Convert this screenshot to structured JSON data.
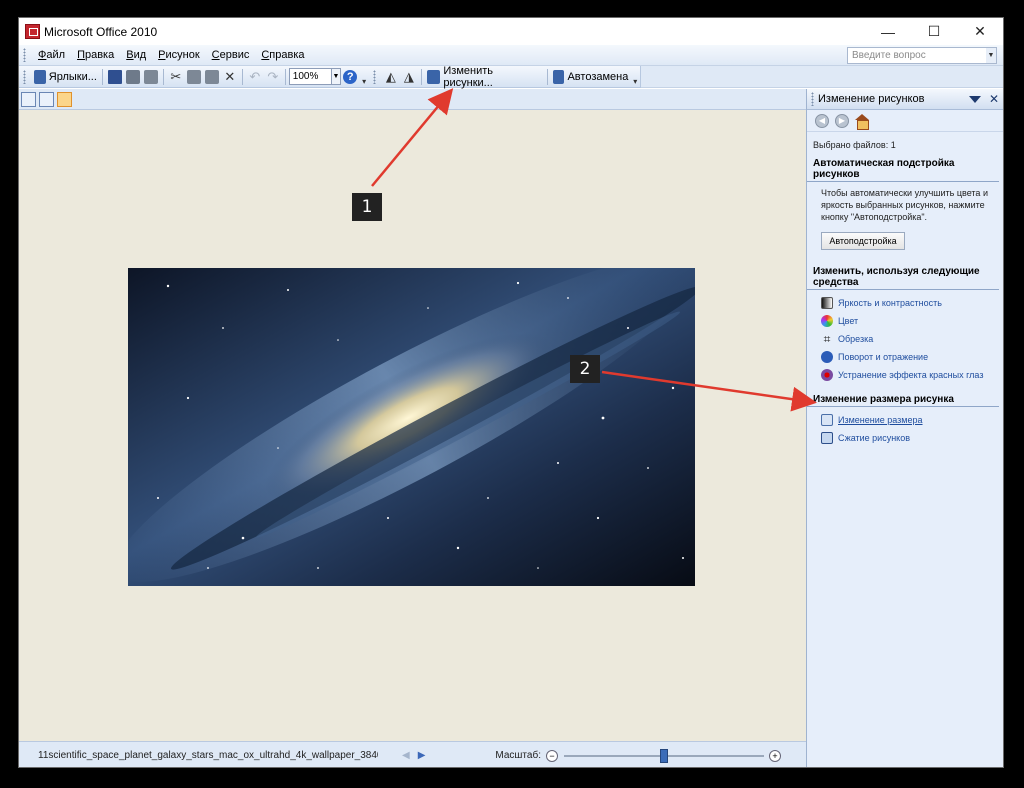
{
  "window": {
    "title": "Microsoft Office 2010",
    "controls": {
      "minimize": "—",
      "maximize": "☐",
      "close": "✕"
    }
  },
  "menu": {
    "items": [
      {
        "key": "Ф",
        "rest": "айл"
      },
      {
        "key": "П",
        "rest": "равка"
      },
      {
        "key": "В",
        "rest": "ид"
      },
      {
        "key": "Р",
        "rest": "исунок"
      },
      {
        "key": "С",
        "rest": "ервис"
      },
      {
        "key": "С",
        "rest": "правка"
      }
    ],
    "question_placeholder": "Введите вопрос"
  },
  "toolbar": {
    "shortcuts_label": "Ярлыки...",
    "zoom_value": "100%",
    "edit_pictures_label": "Изменить рисунки...",
    "autocorrect_label": "Автозамена",
    "icons": [
      "shortcuts-icon",
      "save-icon",
      "print-icon",
      "print-preview-icon",
      "cut-icon",
      "copy-icon",
      "paste-icon",
      "delete-icon",
      "undo-icon",
      "redo-icon",
      "help-icon",
      "rotate-icon",
      "flip-icon",
      "edit-pictures-icon",
      "autocorrect-icon"
    ]
  },
  "statusbar": {
    "filename": "11scientific_space_planet_galaxy_stars_mac_ox_ultrahd_4k_wallpaper_3840...",
    "zoom_label": "Масштаб:",
    "zoom_level": 0.5
  },
  "taskpane": {
    "title": "Изменение рисунков",
    "selected_files": "Выбрано файлов: 1",
    "auto_section": "Автоматическая подстройка рисунков",
    "auto_desc": "Чтобы автоматически улучшить цвета и яркость выбранных рисунков, нажмите кнопку \"Автоподстройка\".",
    "auto_button": "Автоподстройка",
    "tools_section": "Изменить, используя следующие средства",
    "tools": [
      {
        "label": "Яркость и контрастность",
        "icon": "brightness-icon"
      },
      {
        "label": "Цвет",
        "icon": "color-icon"
      },
      {
        "label": "Обрезка",
        "icon": "crop-icon"
      },
      {
        "label": "Поворот и отражение",
        "icon": "rotate-icon"
      },
      {
        "label": "Устранение эффекта красных глаз",
        "icon": "red-eye-icon"
      }
    ],
    "resize_section": "Изменение размера рисунка",
    "resize_links": [
      {
        "label": "Изменение размера",
        "icon": "resize-icon"
      },
      {
        "label": "Сжатие рисунков",
        "icon": "compress-icon"
      }
    ]
  },
  "annotations": {
    "label1": "1",
    "label2": "2"
  },
  "colors": {
    "arrow": "#e03a2e",
    "accent": "#1f4d9e"
  }
}
